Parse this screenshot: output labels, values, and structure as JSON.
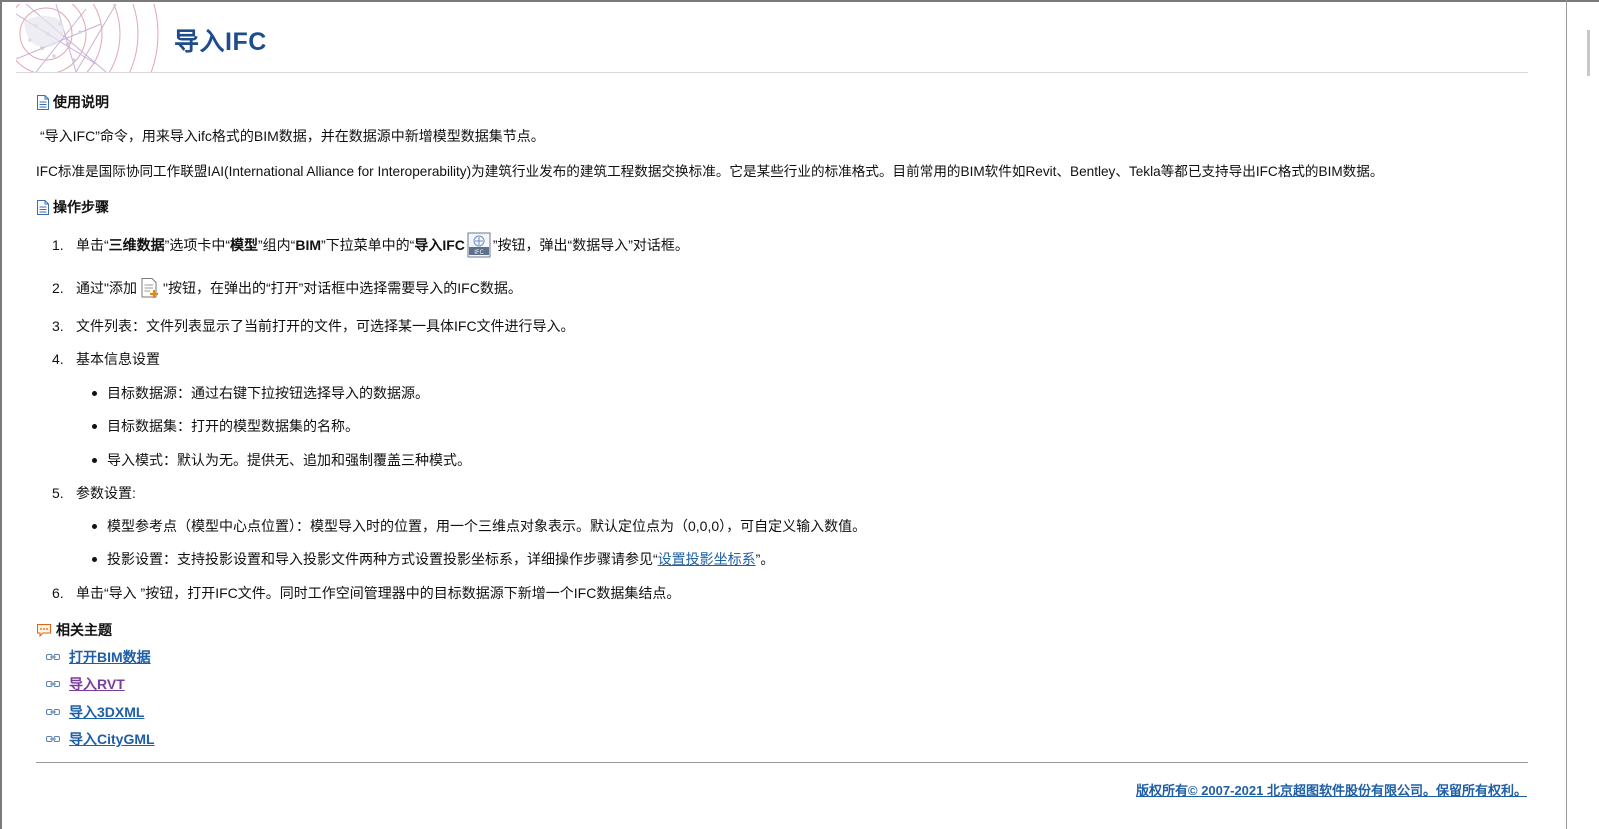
{
  "page": {
    "title": "导入IFC"
  },
  "usage": {
    "heading": "使用说明",
    "para1": "“导入IFC”命令，用来导入ifc格式的BIM数据，并在数据源中新增模型数据集节点。",
    "para2": "IFC标准是国际协同工作联盟IAI(International Alliance for Interoperability)为建筑行业发布的建筑工程数据交换标准。它是某些行业的标准格式。目前常用的BIM软件如Revit、Bentley、Tekla等都已支持导出IFC格式的BIM数据。"
  },
  "steps": {
    "heading": "操作步骤",
    "s1": {
      "num": "1.",
      "t1": "单击“",
      "b1": "三维数据",
      "t2": "”选项卡中“",
      "b2": "模型",
      "t3": "”组内“",
      "b3": "BIM",
      "t4": "”下拉菜单中的“",
      "b4": "导入IFC",
      "t5": "”按钮，弹出“数据导入”对话框。"
    },
    "s2": {
      "num": "2.",
      "t1": "通过\"添加",
      "t2": "\"按钮，在弹出的“打开”对话框中选择需要导入的IFC数据。"
    },
    "s3": {
      "num": "3.",
      "text": "文件列表：文件列表显示了当前打开的文件，可选择某一具体IFC文件进行导入。"
    },
    "s4": {
      "num": "4.",
      "text": "基本信息设置",
      "bullets": [
        "目标数据源：通过右键下拉按钮选择导入的数据源。",
        "目标数据集：打开的模型数据集的名称。",
        "导入模式：默认为无。提供无、追加和强制覆盖三种模式。"
      ]
    },
    "s5": {
      "num": "5.",
      "text": "参数设置:",
      "bullet1": "模型参考点（模型中心点位置）：模型导入时的位置，用一个三维点对象表示。默认定位点为（0,0,0），可自定义输入数值。",
      "bullet2_pre": "投影设置：支持投影设置和导入投影文件两种方式设置投影坐标系，详细操作步骤请参见“",
      "bullet2_link": "设置投影坐标系",
      "bullet2_post": "”。"
    },
    "s6": {
      "num": "6.",
      "text": "单击“导入 ”按钮，打开IFC文件。同时工作空间管理器中的目标数据源下新增一个IFC数据集结点。"
    }
  },
  "related": {
    "heading": "相关主题",
    "links": [
      "打开BIM数据",
      "导入RVT",
      "导入3DXML",
      "导入CityGML"
    ]
  },
  "footer": {
    "copyright": "版权所有© 2007-2021 北京超图软件股份有限公司。保留所有权利。"
  },
  "colors": {
    "title": "#1f4d8c",
    "link": "#1f5fa6",
    "visited_link": "#7b3d9a"
  }
}
